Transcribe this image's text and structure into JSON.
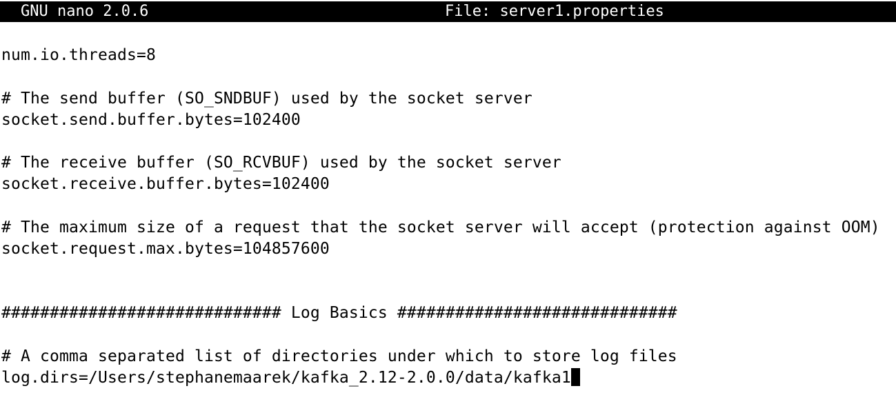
{
  "header": {
    "app_name": "GNU nano 2.0.6",
    "file_label": "File: server1.properties"
  },
  "editor": {
    "lines": [
      "",
      "num.io.threads=8",
      "",
      "# The send buffer (SO_SNDBUF) used by the socket server",
      "socket.send.buffer.bytes=102400",
      "",
      "# The receive buffer (SO_RCVBUF) used by the socket server",
      "socket.receive.buffer.bytes=102400",
      "",
      "# The maximum size of a request that the socket server will accept (protection against OOM)",
      "socket.request.max.bytes=104857600",
      "",
      "",
      "############################# Log Basics #############################",
      "",
      "# A comma separated list of directories under which to store log files",
      "log.dirs=/Users/stephanemaarek/kafka_2.12-2.0.0/data/kafka1"
    ]
  }
}
